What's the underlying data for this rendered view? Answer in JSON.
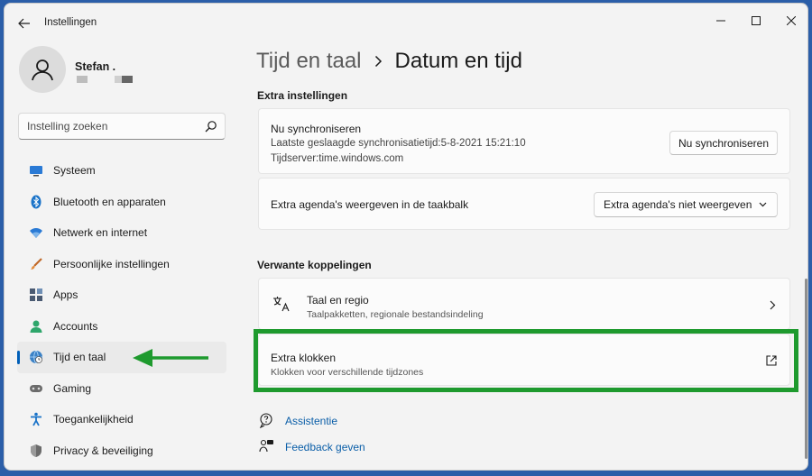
{
  "app": {
    "title": "Instellingen"
  },
  "user": {
    "name": "Stefan ."
  },
  "search": {
    "placeholder": "Instelling zoeken"
  },
  "nav": {
    "items": [
      {
        "label": "Systeem",
        "icon": "monitor-icon"
      },
      {
        "label": "Bluetooth en apparaten",
        "icon": "bluetooth-icon"
      },
      {
        "label": "Netwerk en internet",
        "icon": "wifi-icon"
      },
      {
        "label": "Persoonlijke instellingen",
        "icon": "brush-icon"
      },
      {
        "label": "Apps",
        "icon": "apps-icon"
      },
      {
        "label": "Accounts",
        "icon": "person-icon"
      },
      {
        "label": "Tijd en taal",
        "icon": "globe-clock-icon",
        "active": true
      },
      {
        "label": "Gaming",
        "icon": "gamepad-icon"
      },
      {
        "label": "Toegankelijkheid",
        "icon": "accessibility-icon"
      },
      {
        "label": "Privacy & beveiliging",
        "icon": "shield-icon"
      }
    ]
  },
  "breadcrumb": {
    "parent": "Tijd en taal",
    "current": "Datum en tijd"
  },
  "extra": {
    "heading": "Extra instellingen",
    "sync": {
      "title": "Nu synchroniseren",
      "last_sync": "Laatste geslaagde synchronisatietijd:5-8-2021 15:21:10",
      "server": "Tijdserver:time.windows.com",
      "button": "Nu synchroniseren"
    },
    "calendar": {
      "label": "Extra agenda's weergeven in de taakbalk",
      "selected": "Extra agenda's niet weergeven"
    }
  },
  "related": {
    "heading": "Verwante koppelingen",
    "items": [
      {
        "title": "Taal en regio",
        "subtitle": "Taalpakketten, regionale bestandsindeling"
      },
      {
        "title": "Extra klokken",
        "subtitle": "Klokken voor verschillende tijdzones"
      }
    ]
  },
  "help": {
    "assist": "Assistentie",
    "feedback": "Feedback geven"
  },
  "colors": {
    "accent": "#005fb8",
    "highlight": "#1e9a2e",
    "link": "#0a5ea8"
  }
}
